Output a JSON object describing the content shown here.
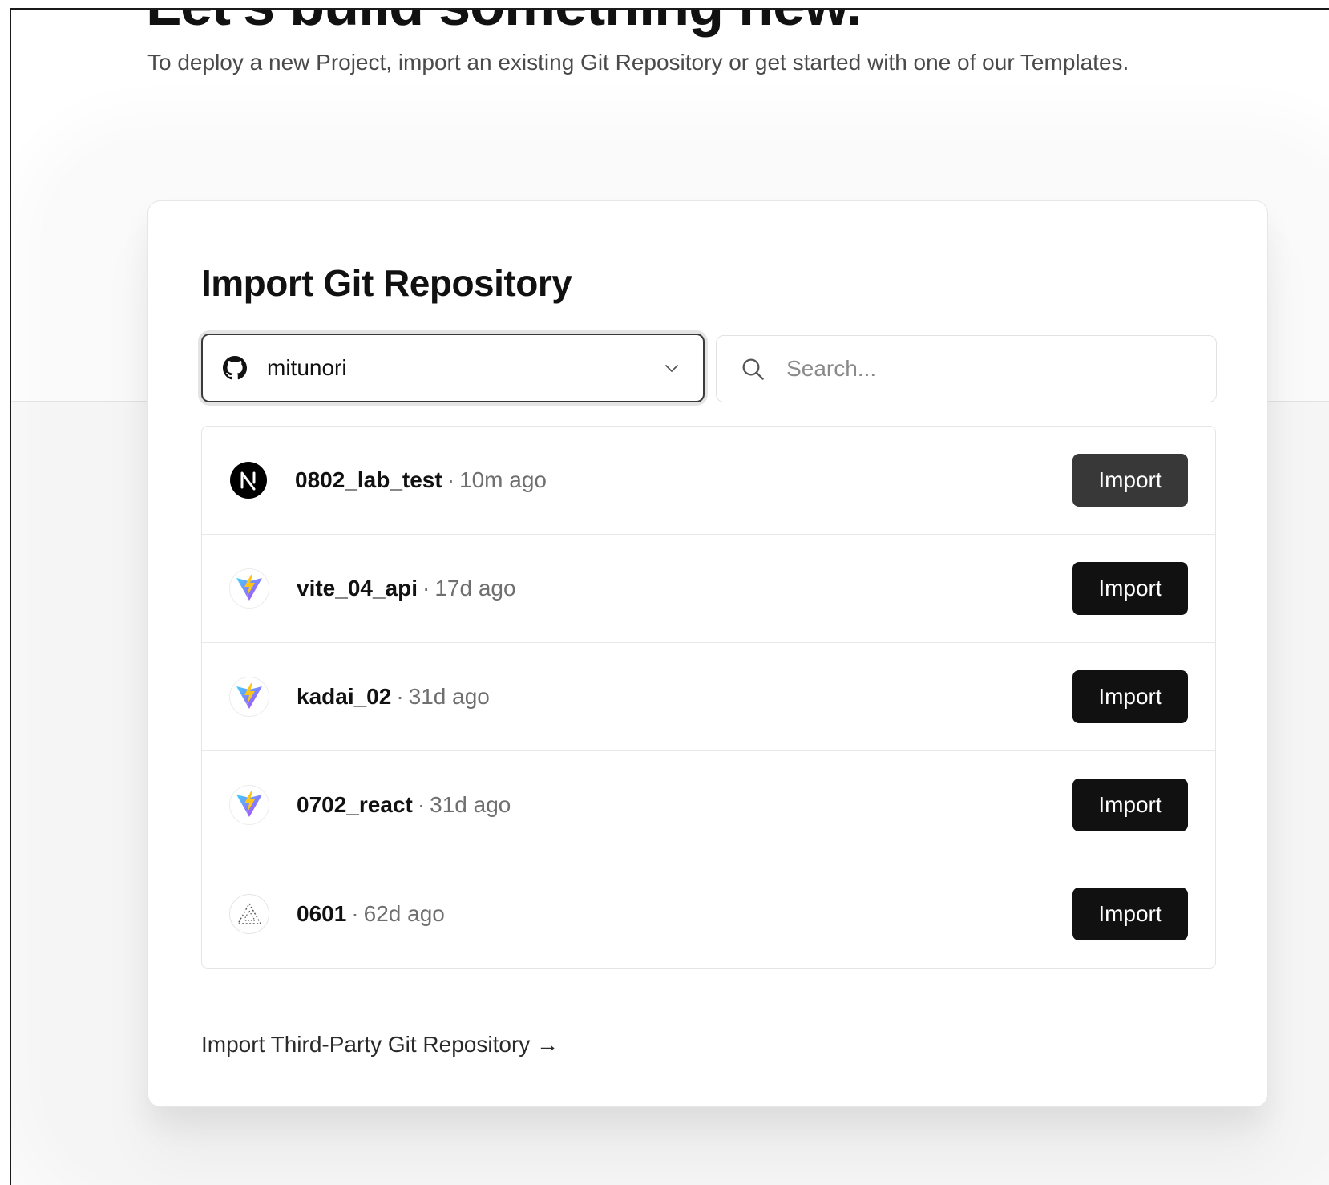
{
  "hero": {
    "title": "Let's build something new.",
    "subtitle": "To deploy a new Project, import an existing Git Repository or get started with one of our Templates."
  },
  "import_card": {
    "title": "Import Git Repository",
    "account_selector": {
      "value": "mitunori",
      "icon": "github-icon",
      "chevron_icon": "chevron-down-icon"
    },
    "search": {
      "placeholder": "Search...",
      "icon": "search-icon"
    },
    "repositories": [
      {
        "name": "0802_lab_test",
        "separator": "·",
        "updated": "10m ago",
        "framework_icon": "nextjs-icon",
        "action": "Import",
        "hovered": true
      },
      {
        "name": "vite_04_api",
        "separator": "·",
        "updated": "17d ago",
        "framework_icon": "vite-icon",
        "action": "Import"
      },
      {
        "name": "kadai_02",
        "separator": "·",
        "updated": "31d ago",
        "framework_icon": "vite-icon",
        "action": "Import"
      },
      {
        "name": "0702_react",
        "separator": "·",
        "updated": "31d ago",
        "framework_icon": "vite-icon",
        "action": "Import"
      },
      {
        "name": "0601",
        "separator": "·",
        "updated": "62d ago",
        "framework_icon": "other-framework-icon",
        "action": "Import"
      }
    ],
    "third_party_link": "Import Third-Party Git Repository →"
  },
  "colors": {
    "button_bg": "#111111",
    "button_hover_bg": "#383838",
    "text_primary": "#111111",
    "text_muted": "#6f6f6f",
    "vite_purple": "#9b5cff",
    "vite_yellow": "#ffc517"
  }
}
